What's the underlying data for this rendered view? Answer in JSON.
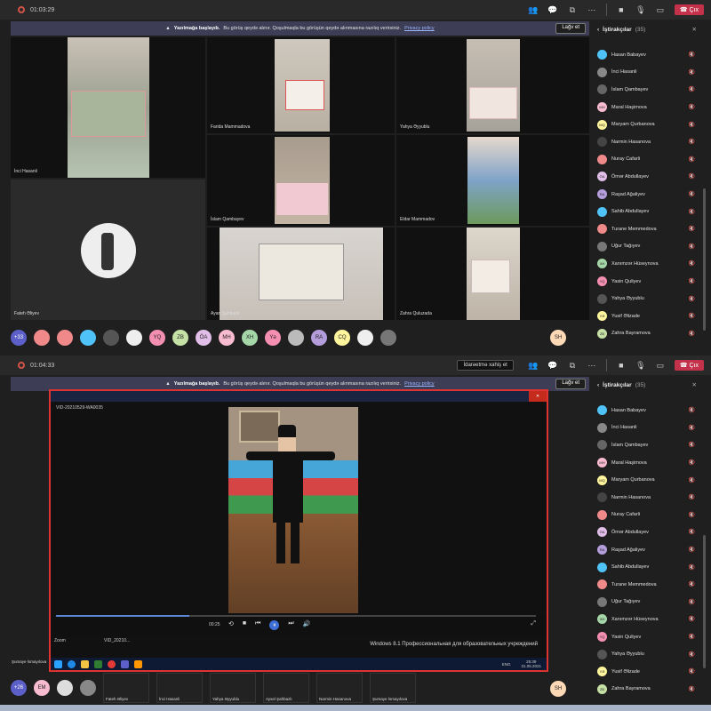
{
  "panel1": {
    "timer": "01:03:29",
    "banner": {
      "bold": "Yazılmağa başlayıb.",
      "text": "Bu görüş qeydə alınır. Qoşulmaqla bu görüşün qeydə alınmasına razılıq verirsiniz.",
      "link": "Privacy policy",
      "button": "Lağv et"
    },
    "leave_label": "Çıx",
    "tiles": [
      {
        "name": "İnci Hasanli"
      },
      {
        "name": "Farida Mammadova"
      },
      {
        "name": "Yahya Əyyublu"
      },
      {
        "name": "Fateh Əliyev"
      },
      {
        "name": "İslam Qambayev"
      },
      {
        "name": "Eldar Mammadov"
      },
      {
        "name": "Ayan Şahbazlı"
      },
      {
        "name": "Zahra Quluzada"
      }
    ],
    "strip": {
      "overflow": "+33",
      "avatars": [
        {
          "t": "",
          "c": "#f08a8a"
        },
        {
          "t": "",
          "c": "#f08a8a"
        },
        {
          "t": "",
          "c": "#4fc3f7"
        },
        {
          "t": "",
          "c": "#555555"
        },
        {
          "t": "",
          "c": "#eeeeee"
        },
        {
          "t": "YQ",
          "c": "#f48fb1"
        },
        {
          "t": "ZB",
          "c": "#c5e1a5"
        },
        {
          "t": "ÖA",
          "c": "#e1bee7"
        },
        {
          "t": "MH",
          "c": "#f8bbd0"
        },
        {
          "t": "XH",
          "c": "#a5d6a7"
        },
        {
          "t": "Yə",
          "c": "#f48fb1"
        },
        {
          "t": "",
          "c": "#bbbbbb"
        },
        {
          "t": "RA",
          "c": "#b39ddb"
        },
        {
          "t": "CQ",
          "c": "#fff59d"
        },
        {
          "t": "",
          "c": "#eeeeee"
        },
        {
          "t": "",
          "c": "#777777"
        }
      ],
      "me": "SH"
    },
    "sidebar": {
      "title": "İştirakçılar",
      "count": "(35)",
      "people": [
        {
          "n": "Hasan Babayev",
          "c": "#4fc3f7",
          "i": ""
        },
        {
          "n": "İnci Hasanli",
          "c": "#888888",
          "i": ""
        },
        {
          "n": "İslam Qambayev",
          "c": "#666666",
          "i": ""
        },
        {
          "n": "Maral Haşimova",
          "c": "#f8bbd0",
          "i": "MH"
        },
        {
          "n": "Maryam Qurbanova",
          "c": "#fff59d",
          "i": "MQ"
        },
        {
          "n": "Narmin Hasanova",
          "c": "#444444",
          "i": ""
        },
        {
          "n": "Nuray Cafarli",
          "c": "#f08a8a",
          "i": ""
        },
        {
          "n": "Ömər Abdullayev",
          "c": "#e1bee7",
          "i": "ÖA"
        },
        {
          "n": "Raşad Ağaliyev",
          "c": "#b39ddb",
          "i": "RA"
        },
        {
          "n": "Sahib Abdullayev",
          "c": "#4fc3f7",
          "i": ""
        },
        {
          "n": "Turane Memmedova",
          "c": "#f08a8a",
          "i": ""
        },
        {
          "n": "Uğur Tağıyev",
          "c": "#777777",
          "i": ""
        },
        {
          "n": "Xanımzər Hüseynova",
          "c": "#a5d6a7",
          "i": "XH"
        },
        {
          "n": "Yasin Quliyev",
          "c": "#f48fb1",
          "i": "YQ"
        },
        {
          "n": "Yahya Əyyublu",
          "c": "#555555",
          "i": ""
        },
        {
          "n": "Yusif Əlizade",
          "c": "#fff59d",
          "i": "YƏ"
        },
        {
          "n": "Zahra Bayramova",
          "c": "#c5e1a5",
          "i": "ZB"
        }
      ]
    }
  },
  "panel2": {
    "timer": "01:04:33",
    "stop_sharing": "İdarəetmə xahiş et",
    "banner": {
      "bold": "Yazılmağa başlayıb.",
      "text": "Bu görüş qeydə alınır. Qoşulmaqla bu görüşün qeydə alınmasına razılıq verirsiniz.",
      "link": "Privacy policy",
      "button": "Lağv et"
    },
    "leave_label": "Çıx",
    "player": {
      "title": "VID-20210529-WA0035",
      "time": "00:25",
      "taskbar_text": "Windows 8.1 Профессиональная для образовательных учреждений",
      "clock": "25:39",
      "date": "31.05.2021",
      "zoom_label": "Zoom",
      "file_label": "VID_20210...",
      "presenter": "Şumaye İsmayılova",
      "lang": "ENG"
    },
    "strip": {
      "overflow": "+26",
      "initial": "EM",
      "me": "SH",
      "thumbs": [
        {
          "name": "Fateh Əliyev"
        },
        {
          "name": "İnci Hasanli"
        },
        {
          "name": "Yahya Əyyublu"
        },
        {
          "name": "Aysel Şahbazlı"
        },
        {
          "name": "Narmin Hasanova"
        },
        {
          "name": "Şumaye İsmayılova"
        }
      ]
    },
    "sidebar": {
      "title": "İştirakçılar",
      "count": "(35)"
    }
  },
  "icons": {
    "mic": "mic-off-icon",
    "people": "people-icon",
    "chat": "chat-icon"
  }
}
